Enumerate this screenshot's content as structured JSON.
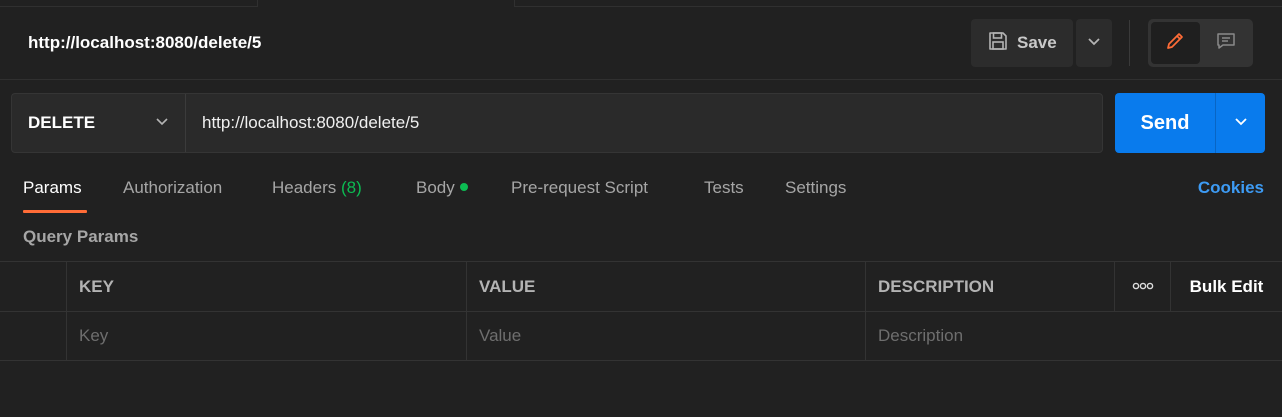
{
  "request": {
    "title": "http://localhost:8080/delete/5",
    "method": "DELETE",
    "url": "http://localhost:8080/delete/5"
  },
  "toolbar": {
    "save_label": "Save",
    "save_icon": "save-icon",
    "edit_icon": "pencil-icon",
    "comments_icon": "comment-icon"
  },
  "send": {
    "label": "Send"
  },
  "tabs": [
    {
      "label": "Params",
      "active": true
    },
    {
      "label": "Authorization"
    },
    {
      "label": "Headers",
      "count": "(8)"
    },
    {
      "label": "Body",
      "indicator": true
    },
    {
      "label": "Pre-request Script"
    },
    {
      "label": "Tests"
    },
    {
      "label": "Settings"
    }
  ],
  "cookies_label": "Cookies",
  "query_params": {
    "title": "Query Params",
    "columns": {
      "key": "KEY",
      "value": "VALUE",
      "description": "DESCRIPTION"
    },
    "bulk_edit": "Bulk Edit",
    "placeholders": {
      "key": "Key",
      "value": "Value",
      "description": "Description"
    }
  },
  "colors": {
    "accent_send": "#097bed",
    "active_tab_underline": "#ff6c37",
    "indicator_green": "#0cbb52",
    "link_blue": "#3d9bf4"
  }
}
